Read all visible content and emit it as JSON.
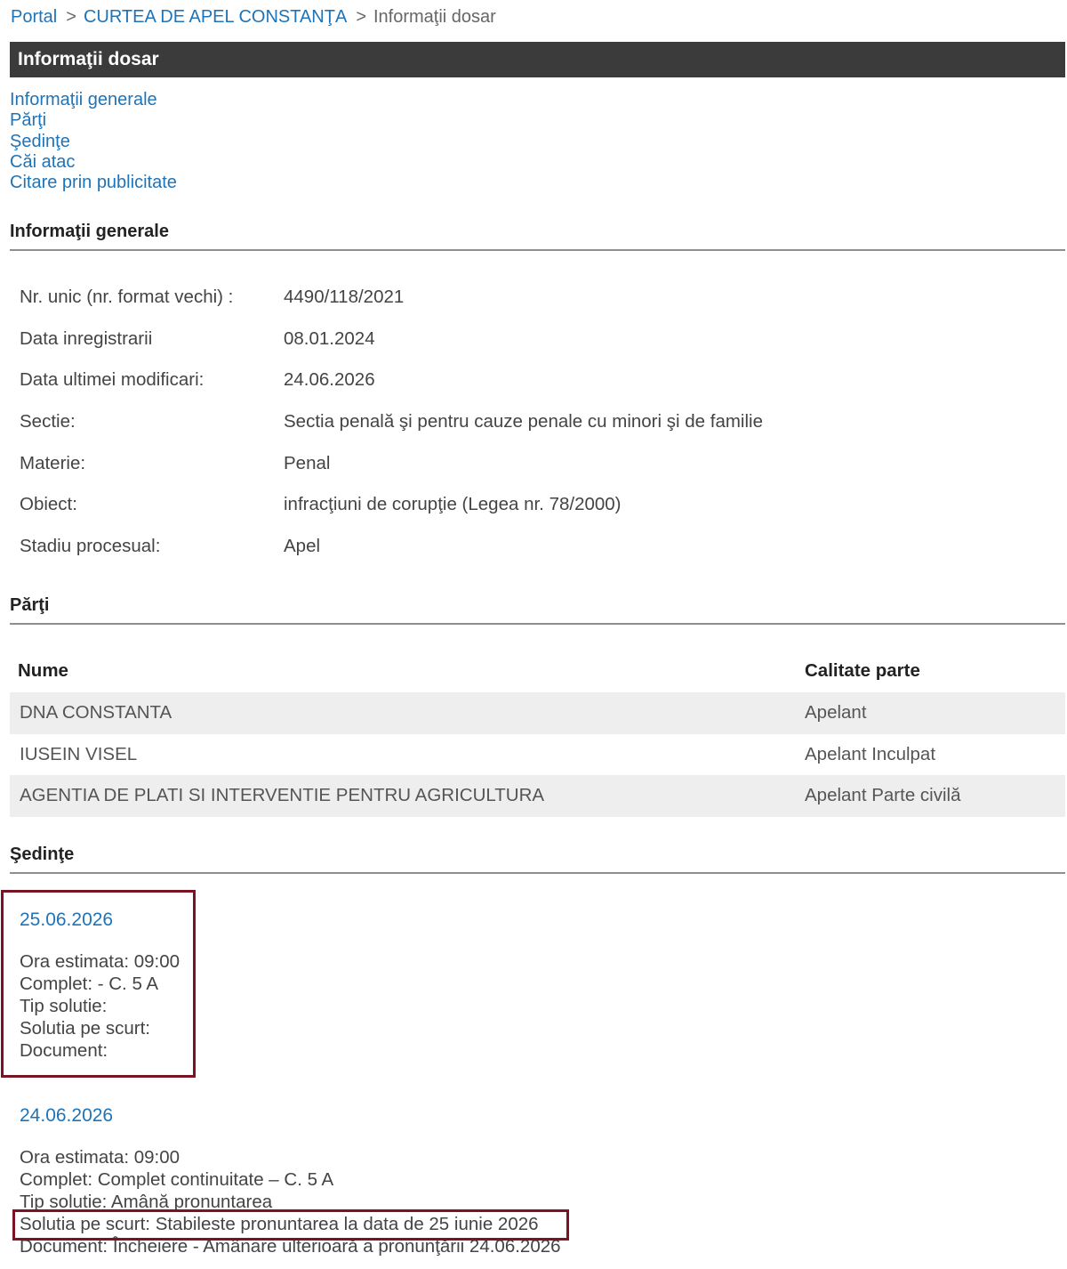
{
  "breadcrumb": {
    "portal": "Portal",
    "sep1": ">",
    "court": "CURTEA DE APEL CONSTANŢA",
    "sep2": ">",
    "current": "Informaţii dosar"
  },
  "title": "Informaţii dosar",
  "toc": [
    "Informaţii generale",
    "Părţi",
    "Şedinţe",
    "Căi atac",
    "Citare prin publicitate"
  ],
  "general": {
    "heading": "Informaţii generale",
    "rows": [
      {
        "label": "Nr. unic (nr. format vechi) :",
        "value": "4490/118/2021"
      },
      {
        "label": "Data inregistrarii",
        "value": "08.01.2024"
      },
      {
        "label": "Data ultimei modificari:",
        "value": "24.06.2026"
      },
      {
        "label": "Sectie:",
        "value": "Sectia penală şi pentru cauze penale cu minori şi de familie"
      },
      {
        "label": "Materie:",
        "value": "Penal"
      },
      {
        "label": "Obiect:",
        "value": "infracţiuni de corupţie (Legea nr. 78/2000)"
      },
      {
        "label": "Stadiu procesual:",
        "value": "Apel"
      }
    ]
  },
  "parties": {
    "heading": "Părţi",
    "columns": [
      "Nume",
      "Calitate parte"
    ],
    "rows": [
      {
        "name": "DNA CONSTANTA",
        "role": "Apelant"
      },
      {
        "name": "IUSEIN VISEL",
        "role": "Apelant Inculpat"
      },
      {
        "name": "AGENTIA DE PLATI SI INTERVENTIE PENTRU AGRICULTURA",
        "role": "Apelant Parte civilă"
      }
    ]
  },
  "sessions": {
    "heading": "Şedinţe",
    "items": [
      {
        "date": "25.06.2026",
        "ora": "Ora estimata: 09:00",
        "complet": "Complet: - C. 5 A",
        "tip": "Tip solutie:",
        "solutia": "Solutia pe scurt:",
        "document": "Document:"
      },
      {
        "date": "24.06.2026",
        "ora": "Ora estimata: 09:00",
        "complet": "Complet: Complet continuitate – C. 5 A",
        "tip": "Tip solutie: Amână pronuntarea",
        "solutia": "Solutia pe scurt: Stabileste pronuntarea la data de 25 iunie 2026",
        "document": "Document: Încheiere - Amânare ulterioară a pronunţării 24.06.2026"
      }
    ]
  },
  "colors": {
    "link": "#1f73b7",
    "title_bar": "#3b3b3b",
    "highlight_box": "#7a1424",
    "row_alt": "#eeeeee"
  }
}
